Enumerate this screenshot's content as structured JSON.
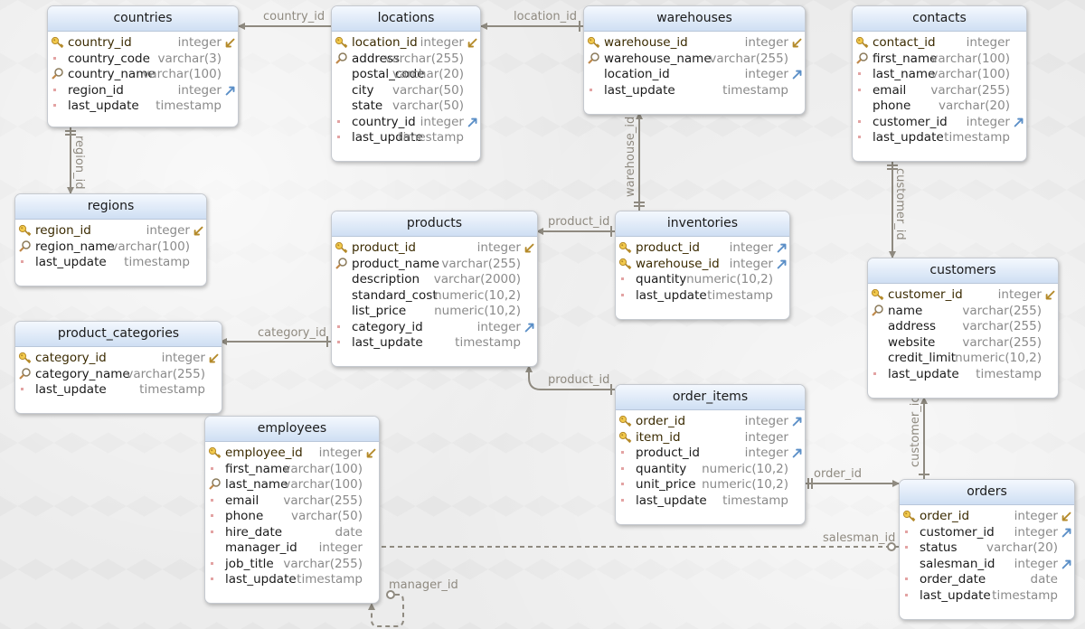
{
  "tables": [
    {
      "id": "countries",
      "name": "countries",
      "columns": [
        {
          "name": "country_id",
          "type": "integer",
          "icon": "key-icon",
          "fk": "pk"
        },
        {
          "name": "country_code",
          "type": "varchar(3)",
          "icon": "required-dot-icon",
          "fk": ""
        },
        {
          "name": "country_name",
          "type": "varchar(100)",
          "icon": "index-icon",
          "fk": ""
        },
        {
          "name": "region_id",
          "type": "integer",
          "icon": "required-dot-icon",
          "fk": "out"
        },
        {
          "name": "last_update",
          "type": "timestamp",
          "icon": "required-dot-icon",
          "fk": ""
        }
      ]
    },
    {
      "id": "locations",
      "name": "locations",
      "columns": [
        {
          "name": "location_id",
          "type": "integer",
          "icon": "key-icon",
          "fk": "pk"
        },
        {
          "name": "address",
          "type": "varchar(255)",
          "icon": "index-icon",
          "fk": ""
        },
        {
          "name": "postal_code",
          "type": "varchar(20)",
          "icon": "",
          "fk": ""
        },
        {
          "name": "city",
          "type": "varchar(50)",
          "icon": "",
          "fk": ""
        },
        {
          "name": "state",
          "type": "varchar(50)",
          "icon": "",
          "fk": ""
        },
        {
          "name": "country_id",
          "type": "integer",
          "icon": "required-dot-icon",
          "fk": "out"
        },
        {
          "name": "last_update",
          "type": "timestamp",
          "icon": "required-dot-icon",
          "fk": ""
        }
      ]
    },
    {
      "id": "warehouses",
      "name": "warehouses",
      "columns": [
        {
          "name": "warehouse_id",
          "type": "integer",
          "icon": "key-icon",
          "fk": "pk"
        },
        {
          "name": "warehouse_name",
          "type": "varchar(255)",
          "icon": "index-icon",
          "fk": ""
        },
        {
          "name": "location_id",
          "type": "integer",
          "icon": "",
          "fk": "out"
        },
        {
          "name": "last_update",
          "type": "timestamp",
          "icon": "required-dot-icon",
          "fk": ""
        }
      ]
    },
    {
      "id": "contacts",
      "name": "contacts",
      "columns": [
        {
          "name": "contact_id",
          "type": "integer",
          "icon": "key-icon",
          "fk": ""
        },
        {
          "name": "first_name",
          "type": "varchar(100)",
          "icon": "index-icon",
          "fk": ""
        },
        {
          "name": "last_name",
          "type": "varchar(100)",
          "icon": "required-dot-icon",
          "fk": ""
        },
        {
          "name": "email",
          "type": "varchar(255)",
          "icon": "required-dot-icon",
          "fk": ""
        },
        {
          "name": "phone",
          "type": "varchar(20)",
          "icon": "",
          "fk": ""
        },
        {
          "name": "customer_id",
          "type": "integer",
          "icon": "required-dot-icon",
          "fk": "out"
        },
        {
          "name": "last_update",
          "type": "timestamp",
          "icon": "required-dot-icon",
          "fk": ""
        }
      ]
    },
    {
      "id": "regions",
      "name": "regions",
      "columns": [
        {
          "name": "region_id",
          "type": "integer",
          "icon": "key-icon",
          "fk": "pk"
        },
        {
          "name": "region_name",
          "type": "varchar(100)",
          "icon": "index-icon",
          "fk": ""
        },
        {
          "name": "last_update",
          "type": "timestamp",
          "icon": "required-dot-icon",
          "fk": ""
        }
      ]
    },
    {
      "id": "products",
      "name": "products",
      "columns": [
        {
          "name": "product_id",
          "type": "integer",
          "icon": "key-icon",
          "fk": "pk"
        },
        {
          "name": "product_name",
          "type": "varchar(255)",
          "icon": "index-icon",
          "fk": ""
        },
        {
          "name": "description",
          "type": "varchar(2000)",
          "icon": "",
          "fk": ""
        },
        {
          "name": "standard_cost",
          "type": "numeric(10,2)",
          "icon": "",
          "fk": ""
        },
        {
          "name": "list_price",
          "type": "numeric(10,2)",
          "icon": "",
          "fk": ""
        },
        {
          "name": "category_id",
          "type": "integer",
          "icon": "required-dot-icon",
          "fk": "out"
        },
        {
          "name": "last_update",
          "type": "timestamp",
          "icon": "required-dot-icon",
          "fk": ""
        }
      ]
    },
    {
      "id": "inventories",
      "name": "inventories",
      "columns": [
        {
          "name": "product_id",
          "type": "integer",
          "icon": "key-icon",
          "fk": "out"
        },
        {
          "name": "warehouse_id",
          "type": "integer",
          "icon": "key-icon",
          "fk": "out"
        },
        {
          "name": "quantity",
          "type": "numeric(10,2)",
          "icon": "required-dot-icon",
          "fk": ""
        },
        {
          "name": "last_update",
          "type": "timestamp",
          "icon": "required-dot-icon",
          "fk": ""
        }
      ]
    },
    {
      "id": "customers",
      "name": "customers",
      "columns": [
        {
          "name": "customer_id",
          "type": "integer",
          "icon": "key-icon",
          "fk": "pk"
        },
        {
          "name": "name",
          "type": "varchar(255)",
          "icon": "index-icon",
          "fk": ""
        },
        {
          "name": "address",
          "type": "varchar(255)",
          "icon": "",
          "fk": ""
        },
        {
          "name": "website",
          "type": "varchar(255)",
          "icon": "",
          "fk": ""
        },
        {
          "name": "credit_limit",
          "type": "numeric(10,2)",
          "icon": "",
          "fk": ""
        },
        {
          "name": "last_update",
          "type": "timestamp",
          "icon": "required-dot-icon",
          "fk": ""
        }
      ]
    },
    {
      "id": "product_categories",
      "name": "product_categories",
      "columns": [
        {
          "name": "category_id",
          "type": "integer",
          "icon": "key-icon",
          "fk": "pk"
        },
        {
          "name": "category_name",
          "type": "varchar(255)",
          "icon": "index-icon",
          "fk": ""
        },
        {
          "name": "last_update",
          "type": "timestamp",
          "icon": "required-dot-icon",
          "fk": ""
        }
      ]
    },
    {
      "id": "order_items",
      "name": "order_items",
      "columns": [
        {
          "name": "order_id",
          "type": "integer",
          "icon": "key-icon",
          "fk": "out"
        },
        {
          "name": "item_id",
          "type": "integer",
          "icon": "key-icon",
          "fk": ""
        },
        {
          "name": "product_id",
          "type": "integer",
          "icon": "required-dot-icon",
          "fk": "out"
        },
        {
          "name": "quantity",
          "type": "numeric(10,2)",
          "icon": "required-dot-icon",
          "fk": ""
        },
        {
          "name": "unit_price",
          "type": "numeric(10,2)",
          "icon": "required-dot-icon",
          "fk": ""
        },
        {
          "name": "last_update",
          "type": "timestamp",
          "icon": "required-dot-icon",
          "fk": ""
        }
      ]
    },
    {
      "id": "employees",
      "name": "employees",
      "columns": [
        {
          "name": "employee_id",
          "type": "integer",
          "icon": "key-icon",
          "fk": "pk"
        },
        {
          "name": "first_name",
          "type": "varchar(100)",
          "icon": "required-dot-icon",
          "fk": ""
        },
        {
          "name": "last_name",
          "type": "varchar(100)",
          "icon": "index-icon",
          "fk": ""
        },
        {
          "name": "email",
          "type": "varchar(255)",
          "icon": "required-dot-icon",
          "fk": ""
        },
        {
          "name": "phone",
          "type": "varchar(50)",
          "icon": "required-dot-icon",
          "fk": ""
        },
        {
          "name": "hire_date",
          "type": "date",
          "icon": "required-dot-icon",
          "fk": ""
        },
        {
          "name": "manager_id",
          "type": "integer",
          "icon": "",
          "fk": ""
        },
        {
          "name": "job_title",
          "type": "varchar(255)",
          "icon": "required-dot-icon",
          "fk": ""
        },
        {
          "name": "last_update",
          "type": "timestamp",
          "icon": "required-dot-icon",
          "fk": ""
        }
      ]
    },
    {
      "id": "orders",
      "name": "orders",
      "columns": [
        {
          "name": "order_id",
          "type": "integer",
          "icon": "key-icon",
          "fk": "pk"
        },
        {
          "name": "customer_id",
          "type": "integer",
          "icon": "required-dot-icon",
          "fk": "out"
        },
        {
          "name": "status",
          "type": "varchar(20)",
          "icon": "required-dot-icon",
          "fk": ""
        },
        {
          "name": "salesman_id",
          "type": "integer",
          "icon": "",
          "fk": "out"
        },
        {
          "name": "order_date",
          "type": "date",
          "icon": "required-dot-icon",
          "fk": ""
        },
        {
          "name": "last_update",
          "type": "timestamp",
          "icon": "required-dot-icon",
          "fk": ""
        }
      ]
    }
  ],
  "relationships": [
    {
      "id": "rel-country",
      "label": "country_id"
    },
    {
      "id": "rel-location",
      "label": "location_id"
    },
    {
      "id": "rel-region",
      "label": "region_id"
    },
    {
      "id": "rel-warehouse",
      "label": "warehouse_id"
    },
    {
      "id": "rel-customer-contacts",
      "label": "customer_id"
    },
    {
      "id": "rel-product-inv",
      "label": "product_id"
    },
    {
      "id": "rel-category",
      "label": "category_id"
    },
    {
      "id": "rel-product-items",
      "label": "product_id"
    },
    {
      "id": "rel-order",
      "label": "order_id"
    },
    {
      "id": "rel-customer-orders",
      "label": "customer_id"
    },
    {
      "id": "rel-salesman",
      "label": "salesman_id"
    },
    {
      "id": "rel-manager",
      "label": "manager_id"
    }
  ],
  "colors": {
    "line": "#8f8a80",
    "header_top": "#f4f8fe",
    "header_bottom": "#cfdff3",
    "fk_arrow": "#5b8fc7",
    "pk_fk_arrow": "#b48a2a"
  }
}
